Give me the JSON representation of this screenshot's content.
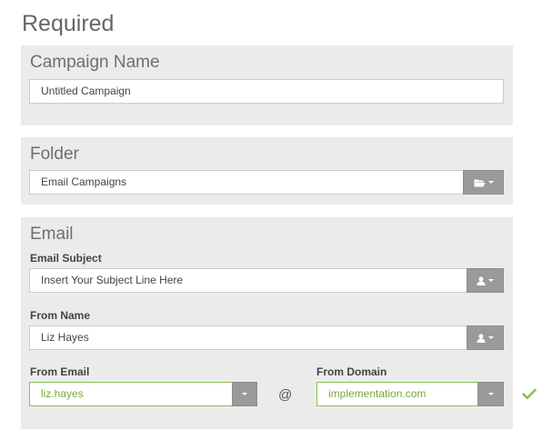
{
  "heading": "Required",
  "campaign": {
    "title": "Campaign Name",
    "value": "Untitled Campaign"
  },
  "folder": {
    "title": "Folder",
    "value": "Email Campaigns",
    "button_icon": "folder-open-icon"
  },
  "email": {
    "title": "Email",
    "subject_label": "Email Subject",
    "subject_value": "Insert Your Subject Line Here",
    "from_name_label": "From Name",
    "from_name_value": "Liz Hayes",
    "from_email_label": "From Email",
    "from_email_value": "liz.hayes",
    "at": "@",
    "from_domain_label": "From Domain",
    "from_domain_value": "implementation.com",
    "button_icon": "user-icon",
    "valid_icon": "checkmark-icon"
  },
  "colors": {
    "panel_bg": "#ebebeb",
    "button_bg": "#9a9a9a",
    "valid_green": "#8cc152"
  }
}
